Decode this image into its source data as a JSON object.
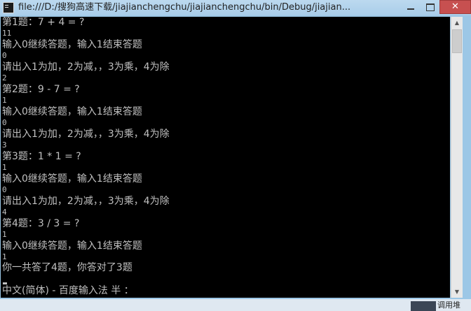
{
  "window": {
    "title": "file:///D:/搜狗高速下载/jiajianchengchu/jiajianchengchu/bin/Debug/jiajian...",
    "minimize_glyph": "",
    "maximize_glyph": "",
    "close_glyph": "✕"
  },
  "console": {
    "lines": [
      "第1题：7 + 4 = ?",
      "11",
      "输入0继续答题，输入1结束答题",
      "0",
      "请出入1为加，2为减，，3为乘，4为除",
      "2",
      "第2题：9 - 7 = ?",
      "1",
      "输入0继续答题，输入1结束答题",
      "0",
      "请出入1为加，2为减，，3为乘，4为除",
      "3",
      "第3题：1 * 1 = ?",
      "1",
      "输入0继续答题，输入1结束答题",
      "0",
      "请出入1为加，2为减，，3为乘，4为除",
      "4",
      "第4题：3 / 3 = ?",
      "1",
      "输入0继续答题，输入1结束答题",
      "1",
      "你一共答了4题，你答对了3题",
      "中文(简体) - 百度输入法 半 ："
    ]
  },
  "scrollbar": {
    "up_arrow": "▲",
    "down_arrow": "▼"
  },
  "taskbar": {
    "partial_text": "调用堆"
  },
  "colors": {
    "console_bg": "#000000",
    "console_fg": "#c0c0c0",
    "titlebar": "#a9cde9",
    "close_button": "#c75050"
  }
}
